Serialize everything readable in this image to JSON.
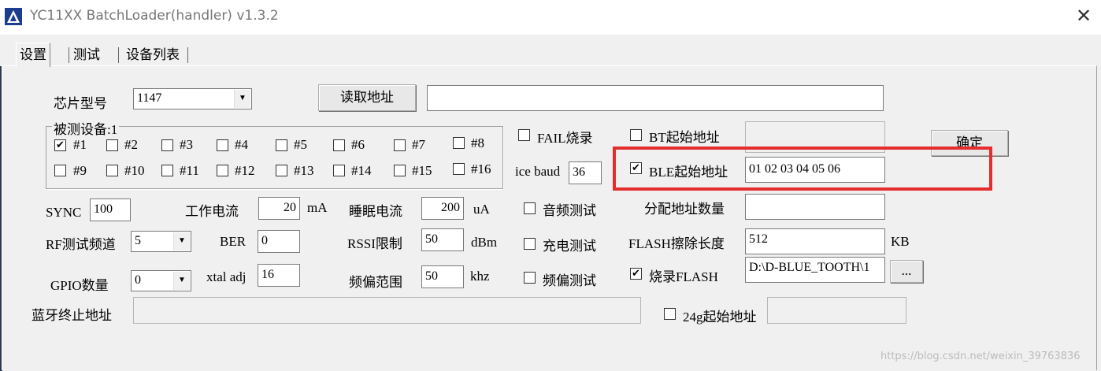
{
  "window": {
    "title": "YC11XX BatchLoader(handler) v1.3.2",
    "close": "✕"
  },
  "tabs": [
    {
      "label": "设置"
    },
    {
      "label": "测试"
    },
    {
      "label": "设备列表"
    }
  ],
  "chip": {
    "label": "芯片型号",
    "value": "1147"
  },
  "read_address": {
    "button": "读取地址",
    "value": ""
  },
  "devices": {
    "title": "被测设备:1",
    "items": [
      {
        "label": "#1",
        "checked": true
      },
      {
        "label": "#2",
        "checked": false
      },
      {
        "label": "#3",
        "checked": false
      },
      {
        "label": "#4",
        "checked": false
      },
      {
        "label": "#5",
        "checked": false
      },
      {
        "label": "#6",
        "checked": false
      },
      {
        "label": "#7",
        "checked": false
      },
      {
        "label": "#8",
        "checked": false
      },
      {
        "label": "#9",
        "checked": false
      },
      {
        "label": "#10",
        "checked": false
      },
      {
        "label": "#11",
        "checked": false
      },
      {
        "label": "#12",
        "checked": false
      },
      {
        "label": "#13",
        "checked": false
      },
      {
        "label": "#14",
        "checked": false
      },
      {
        "label": "#15",
        "checked": false
      },
      {
        "label": "#16",
        "checked": false
      }
    ]
  },
  "fail_burn": {
    "label": "FAIL烧录",
    "checked": false
  },
  "ice_baud": {
    "label": "ice baud",
    "value": "36"
  },
  "bt_start": {
    "label": "BT起始地址",
    "checked": false,
    "value": ""
  },
  "ble_start": {
    "label": "BLE起始地址",
    "checked": true,
    "value": "01 02 03 04 05 06"
  },
  "confirm": {
    "label": "确定"
  },
  "sync": {
    "label": "SYNC",
    "value": "100"
  },
  "work_current": {
    "label": "工作电流",
    "value": "20",
    "unit": "mA"
  },
  "sleep_current": {
    "label": "睡眠电流",
    "value": "200",
    "unit": "uA"
  },
  "audio_test": {
    "label": "音频测试",
    "checked": false
  },
  "alloc_count": {
    "label": "分配地址数量",
    "value": ""
  },
  "rf_channel": {
    "label": "RF测试频道",
    "value": "5"
  },
  "ber": {
    "label": "BER",
    "value": "0"
  },
  "rssi": {
    "label": "RSSI限制",
    "value": "50",
    "unit": "dBm"
  },
  "charge_test": {
    "label": "充电测试",
    "checked": false
  },
  "flash_erase": {
    "label": "FLASH擦除长度",
    "value": "512",
    "unit": "KB"
  },
  "gpio": {
    "label": "GPIO数量",
    "value": "0"
  },
  "xtal": {
    "label": "xtal adj",
    "value": "16"
  },
  "freq_range": {
    "label": "频偏范围",
    "value": "50",
    "unit": "khz"
  },
  "freq_test": {
    "label": "频偏测试",
    "checked": false
  },
  "burn_flash": {
    "label": "烧录FLASH",
    "checked": true,
    "value": "D:\\D-BLUE_TOOTH\\1",
    "browse": "..."
  },
  "bt_end": {
    "label": "蓝牙终止地址",
    "value": ""
  },
  "g24_start": {
    "label": "24g起始地址",
    "checked": false,
    "value": ""
  },
  "watermark": "https://blog.csdn.net/weixin_39763836",
  "colors": {
    "highlight": "#e52d2d",
    "background": "#f0f0f0"
  }
}
